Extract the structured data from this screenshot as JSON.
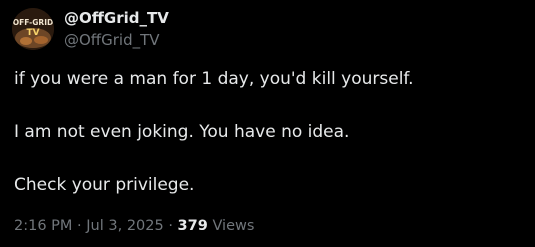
{
  "author": {
    "avatar_icon": "offgrid-tv-logo-icon",
    "avatar_logo_text_top": "OFF-GRID",
    "avatar_logo_text_bottom": "TV",
    "display_name": "@OffGrid_TV",
    "handle": "@OffGrid_TV"
  },
  "tweet": {
    "lines": [
      "if you were a man for 1 day, you'd kill yourself.",
      "I am not even joking.  You have no idea.",
      "Check your privilege."
    ]
  },
  "meta": {
    "time": "2:16 PM",
    "separator": "·",
    "date": "Jul 3, 2025",
    "views_count": "379",
    "views_label": "Views"
  },
  "colors": {
    "background": "#000000",
    "text_primary": "#e7e9ea",
    "text_secondary": "#71767b"
  }
}
